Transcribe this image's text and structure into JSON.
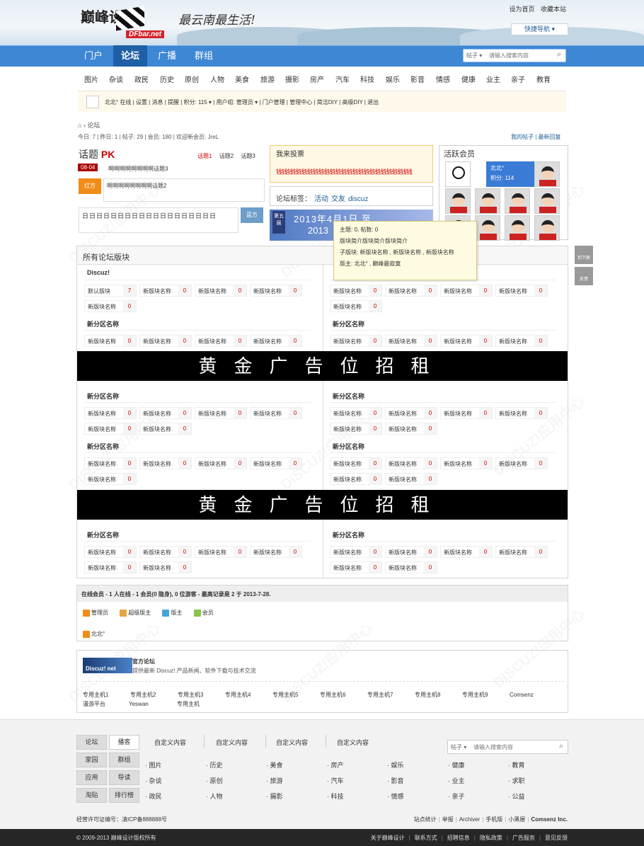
{
  "header": {
    "logo_main": "巅峰设计",
    "logo_sub": "DFbar.net",
    "slogan": "最云南最生活!",
    "top_links": [
      "设为首页",
      "收藏本站"
    ],
    "quick_nav": "快捷导航 ▾"
  },
  "nav": {
    "items": [
      "门户",
      "论坛",
      "广播",
      "群组"
    ],
    "active": "论坛",
    "search_type": "帖子 ▾",
    "search_placeholder": "请输入搜索内容"
  },
  "subnav": [
    "图片",
    "杂谈",
    "政民",
    "历史",
    "原创",
    "人物",
    "美食",
    "旅游",
    "摄影",
    "房产",
    "汽车",
    "科技",
    "娱乐",
    "影音",
    "情感",
    "健康",
    "业主",
    "亲子",
    "教育"
  ],
  "userbar": {
    "text": "北北° 在线 | 设置 | 消息 | 提醒 | 积分: 115 ▾ | 用户组: 管理员 ▾ | 门户管理 | 管理中心 | 简洁DIY | 高级DIY | 退出"
  },
  "breadcrumb": "⌂ › 论坛",
  "stats": {
    "text": "今日: 7 | 昨日: 1 | 帖子: 29 | 会员: 180 | 欢迎新会员: JreL",
    "links": "我的帖子 | 最新回复"
  },
  "pk": {
    "title_prefix": "话题",
    "title_pk": "PK",
    "tabs": [
      "话题1",
      "话题2",
      "话题3"
    ],
    "date": "08-04",
    "topic": "啊啊啊啊啊啊啊啊话题3",
    "red_label": "红方",
    "red_text": "啊啊啊啊啊啊啊啊话题2",
    "blue_label": "蓝方",
    "blue_text": "日日日日日日日日日日日日日日日日日日日"
  },
  "vote": {
    "title": "我来投票",
    "content": "钱钱钱钱钱钱钱钱钱钱钱钱钱钱钱钱钱钱钱钱钱钱钱钱"
  },
  "tags": {
    "label": "论坛标签：",
    "items": [
      "活动",
      "交友",
      "discuz"
    ]
  },
  "promo": {
    "badge": "第五届",
    "line1": "2013年4月1日 至",
    "line2": "2013"
  },
  "tooltip": {
    "lines": [
      "主题: 0, 帖数: 0",
      "版块简介版块简介版块简介",
      "子版块: 新版块名称 , 新版块名称 , 新版块名称",
      "版主: 北北° , 巅峰最寂寞"
    ]
  },
  "members": {
    "title": "活跃会员",
    "featured_name": "北北°",
    "featured_score": "积分: 114"
  },
  "side_buttons": [
    "到下面",
    "反馈"
  ],
  "forum": {
    "title": "所有论坛版块",
    "ad_text": "黄金广告位招租",
    "rows": [
      {
        "left": {
          "name": "Discuz!",
          "cells": [
            [
              "默认版块",
              "7"
            ],
            [
              "新版块名称",
              "0"
            ],
            [
              "新版块名称",
              "0"
            ],
            [
              "新版块名称",
              "0"
            ],
            [
              "新版块名称",
              "0"
            ]
          ]
        },
        "right": {
          "name": "",
          "cells": [
            [
              "新版块名称",
              "0"
            ],
            [
              "新版块名称",
              "0"
            ],
            [
              "新版块名称",
              "0"
            ],
            [
              "新版块名称",
              "0"
            ],
            [
              "新版块名称",
              "0"
            ]
          ]
        }
      },
      {
        "left": {
          "name": "新分区名称",
          "cells": [
            [
              "新版块名称",
              "0"
            ],
            [
              "新版块名称",
              "0"
            ],
            [
              "新版块名称",
              "0"
            ],
            [
              "新版块名称",
              "0"
            ]
          ]
        },
        "right": {
          "name": "新分区名称",
          "cells": [
            [
              "新版块名称",
              "0"
            ],
            [
              "新版块名称",
              "0"
            ],
            [
              "新版块名称",
              "0"
            ],
            [
              "新版块名称",
              "0"
            ]
          ]
        }
      },
      {
        "left": {
          "name": "新分区名称",
          "cells": [
            [
              "新版块名称",
              "0"
            ],
            [
              "新版块名称",
              "0"
            ],
            [
              "新版块名称",
              "0"
            ],
            [
              "新版块名称",
              "0"
            ],
            [
              "新版块名称",
              "0"
            ],
            [
              "新版块名称",
              "0"
            ]
          ]
        },
        "right": {
          "name": "新分区名称",
          "cells": [
            [
              "新版块名称",
              "0"
            ],
            [
              "新版块名称",
              "0"
            ],
            [
              "新版块名称",
              "0"
            ],
            [
              "新版块名称",
              "0"
            ],
            [
              "新版块名称",
              "0"
            ],
            [
              "新版块名称",
              "0"
            ]
          ]
        }
      },
      {
        "left": {
          "name": "新分区名称",
          "cells": [
            [
              "新版块名称",
              "0"
            ],
            [
              "新版块名称",
              "0"
            ],
            [
              "新版块名称",
              "0"
            ],
            [
              "新版块名称",
              "0"
            ],
            [
              "新版块名称",
              "0"
            ]
          ]
        },
        "right": {
          "name": "新分区名称",
          "cells": [
            [
              "新版块名称",
              "0"
            ],
            [
              "新版块名称",
              "0"
            ],
            [
              "新版块名称",
              "0"
            ],
            [
              "新版块名称",
              "0"
            ],
            [
              "新版块名称",
              "0"
            ],
            [
              "新版块名称",
              "0"
            ]
          ]
        }
      },
      {
        "left": {
          "name": "新分区名称",
          "cells": [
            [
              "新版块名称",
              "0"
            ],
            [
              "新版块名称",
              "0"
            ],
            [
              "新版块名称",
              "0"
            ],
            [
              "新版块名称",
              "0"
            ],
            [
              "新版块名称",
              "0"
            ],
            [
              "新版块名称",
              "0"
            ]
          ]
        },
        "right": {
          "name": "新分区名称",
          "cells": [
            [
              "新版块名称",
              "0"
            ],
            [
              "新版块名称",
              "0"
            ],
            [
              "新版块名称",
              "0"
            ],
            [
              "新版块名称",
              "0"
            ],
            [
              "新版块名称",
              "0"
            ],
            [
              "新版块名称",
              "0"
            ]
          ]
        }
      }
    ]
  },
  "online": {
    "header": "在线会员 - 1 人在线 - 1 会员(0 隐身), 0 位游客 - 最高记录是 2 于 2013-7-28.",
    "legend": [
      "管理员",
      "超级版主",
      "版主",
      "会员"
    ],
    "legend_colors": [
      "#f28c19",
      "#e8a33d",
      "#4aa3d8",
      "#8bc34a"
    ],
    "user": "北北°"
  },
  "links": {
    "logo": "Discuz! net",
    "name": "官方论坛",
    "desc": "提供最新 Discuz! 产品新闻、软件下载与技术交流",
    "items": [
      "专用主机1",
      "专用主机2",
      "专用主机3",
      "专用主机4",
      "专用主机5",
      "专用主机6",
      "专用主机7",
      "专用主机8",
      "专用主机9",
      "Comsenz"
    ],
    "items2": [
      "漫游平台",
      "Yeswan",
      "专用主机"
    ]
  },
  "footer": {
    "buttons": [
      "论坛",
      "播客",
      "家园",
      "群组",
      "应用",
      "导读",
      "淘贴",
      "排行榜"
    ],
    "heads": [
      "自定义内容",
      "自定义内容",
      "自定义内容",
      "自定义内容"
    ],
    "cols": [
      [
        "图片",
        "杂谈",
        "政民"
      ],
      [
        "历史",
        "原创",
        "人物"
      ],
      [
        "美食",
        "旅游",
        "摄影"
      ],
      [
        "房产",
        "汽车",
        "科技"
      ],
      [
        "娱乐",
        "影音",
        "情感"
      ],
      [
        "健康",
        "业主",
        "亲子"
      ],
      [
        "教育",
        "求职",
        "公益"
      ]
    ],
    "search_type": "帖子 ▾",
    "search_placeholder": "请输入搜索内容",
    "icp": "经营许可证编号：滇ICP备888888号",
    "bottom_links": [
      "站点统计",
      "举报",
      "Archiver",
      "手机版",
      "小黑屋",
      "Comsenz Inc."
    ],
    "copyright": "© 2009-2013 巅峰设计版权所有",
    "bar_links": [
      "关于巅峰设计",
      "联系方式",
      "招聘信息",
      "隐私政策",
      "广告服务",
      "意见反馈"
    ]
  }
}
